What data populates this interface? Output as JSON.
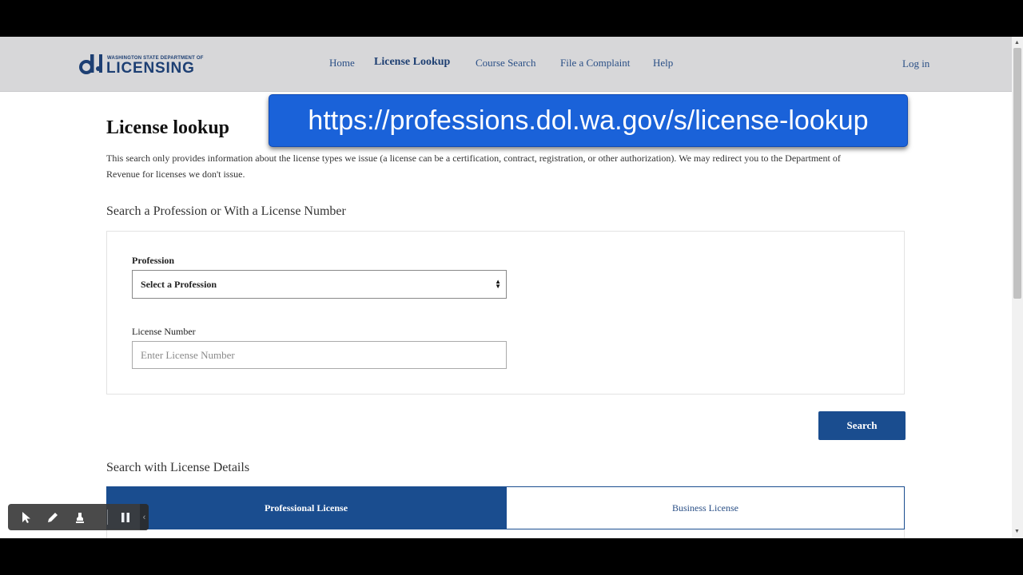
{
  "header": {
    "logo_small": "WASHINGTON STATE DEPARTMENT OF",
    "logo_big": "LICENSING",
    "logo_mark": "dol",
    "nav": [
      {
        "label": "Home",
        "active": false
      },
      {
        "label": "License Lookup",
        "active": true
      },
      {
        "label": "Course Search",
        "active": false
      },
      {
        "label": "File a Complaint",
        "active": false
      },
      {
        "label": "Help",
        "active": false
      }
    ],
    "login": "Log in"
  },
  "url_banner": "https://professions.dol.wa.gov/s/license-lookup",
  "page": {
    "title": "License lookup",
    "intro": "This search only provides information about the license types we issue (a license can be a certification, contract, registration, or other authorization). We may redirect you to the Department of Revenue for licenses we don't issue.",
    "section1_title": "Search a Profession or With a License Number",
    "profession_label": "Profession",
    "profession_selected": "Select a Profession",
    "license_label": "License Number",
    "license_placeholder": "Enter License Number",
    "search_button": "Search",
    "section2_title": "Search with License Details",
    "tabs": [
      {
        "label": "Professional License",
        "active": true
      },
      {
        "label": "Business License",
        "active": false
      }
    ]
  },
  "colors": {
    "header_bg": "#d7d7d9",
    "primary": "#1a4d8f",
    "link": "#2a4f86",
    "url_banner": "#1a62d9"
  },
  "icons": {
    "select_arrows": "sort-arrows-icon",
    "toolbar": [
      "cursor-icon",
      "pen-icon",
      "highlighter-icon",
      "pause-icon",
      "chevron-left-icon"
    ]
  }
}
